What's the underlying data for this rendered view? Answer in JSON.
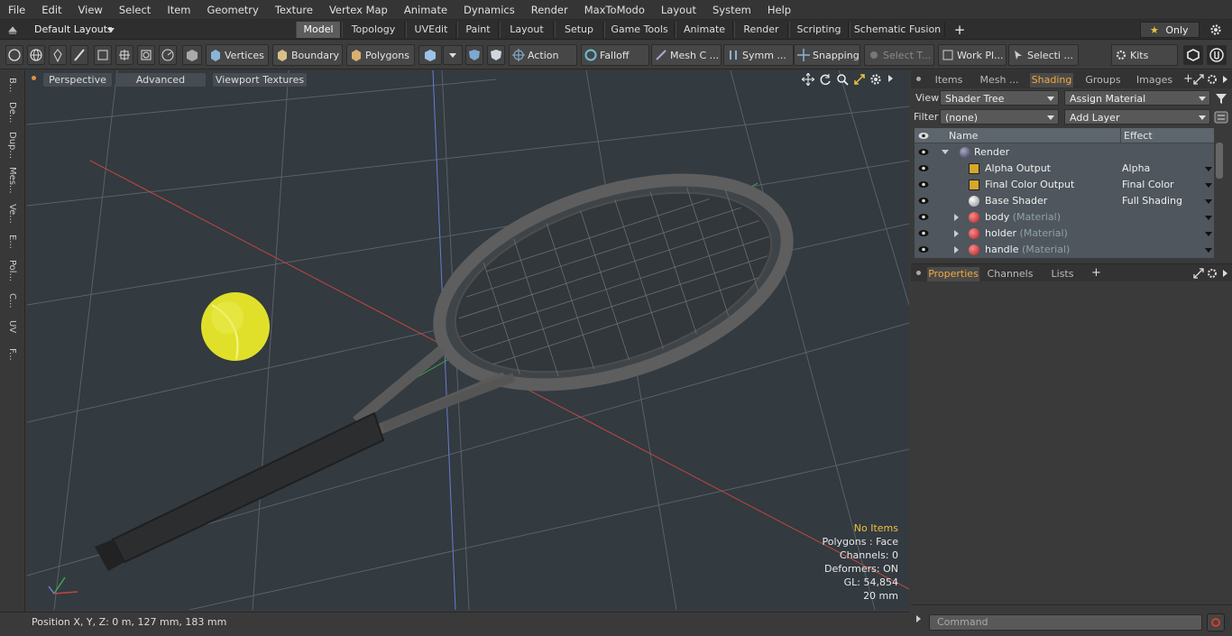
{
  "menu": [
    "File",
    "Edit",
    "View",
    "Select",
    "Item",
    "Geometry",
    "Texture",
    "Vertex Map",
    "Animate",
    "Dynamics",
    "Render",
    "MaxToModo",
    "Layout",
    "System",
    "Help"
  ],
  "layout_selector": "Default Layouts",
  "layout_tabs": [
    "Model",
    "Topology",
    "UVEdit",
    "Paint",
    "Layout",
    "Setup",
    "Game Tools",
    "Animate",
    "Render",
    "Scripting",
    "Schematic Fusion"
  ],
  "active_layout_tab": "Model",
  "only_label": "Only",
  "toolbar": {
    "vertices": "Vertices",
    "boundary": "Boundary",
    "polygons": "Polygons",
    "action": "Action",
    "falloff": "Falloff",
    "mesh_c": "Mesh C ...",
    "symm": "Symm ...",
    "snapping": "Snapping",
    "select_t": "Select T...",
    "work_pl": "Work Pl...",
    "selecti": "Selecti ...",
    "kits": "Kits"
  },
  "left_tabs": [
    "B...",
    "De...",
    "Dup...",
    "Mes...",
    "Ve...",
    "E...",
    "Pol...",
    "C...",
    "UV",
    "F..."
  ],
  "viewport": {
    "tabs": [
      "Perspective",
      "Advanced",
      "Viewport Textures"
    ],
    "info": {
      "selection": "No Items",
      "polygons": "Polygons : Face",
      "channels": "Channels: 0",
      "deformers": "Deformers: ON",
      "gl": "GL: 54,854",
      "scale": "20 mm"
    }
  },
  "status": "Position X, Y, Z:   0 m, 127 mm, 183 mm",
  "right_tabs": [
    "Items",
    "Mesh ...",
    "Shading",
    "Groups",
    "Images"
  ],
  "active_right_tab": "Shading",
  "shading": {
    "view_label": "View",
    "view_value": "Shader Tree",
    "assign_material": "Assign Material",
    "filter_label": "Filter",
    "filter_value": "(none)",
    "add_layer": "Add Layer",
    "col_name": "Name",
    "col_effect": "Effect",
    "rows": [
      {
        "name": "Render",
        "sub": "",
        "effect": ""
      },
      {
        "name": "Alpha Output",
        "sub": "",
        "effect": "Alpha"
      },
      {
        "name": "Final Color Output",
        "sub": "",
        "effect": "Final Color"
      },
      {
        "name": "Base Shader",
        "sub": "",
        "effect": "Full Shading"
      },
      {
        "name": "body",
        "sub": "(Material)",
        "effect": ""
      },
      {
        "name": "holder",
        "sub": "(Material)",
        "effect": ""
      },
      {
        "name": "handle",
        "sub": "(Material)",
        "effect": ""
      }
    ]
  },
  "bottom_tabs": [
    "Properties",
    "Channels",
    "Lists"
  ],
  "active_bottom_tab": "Properties",
  "command_placeholder": "Command"
}
